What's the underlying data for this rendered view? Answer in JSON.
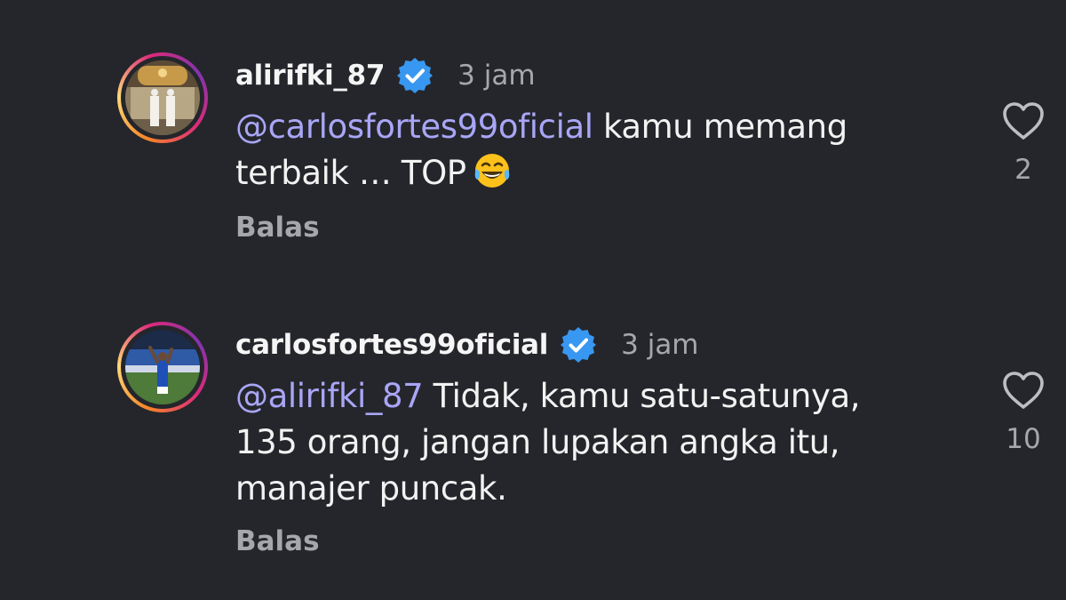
{
  "comments": [
    {
      "username": "alirifki_87",
      "verified_icon": "verified-badge-icon",
      "time": "3 jam",
      "mention": "@carlosfortes99oficial",
      "text_line1": " kamu memang",
      "text_line2": "terbaik … TOP",
      "emoji": "face-with-tears-of-joy-icon",
      "reply_label": "Balas",
      "like_icon": "heart-outline-icon",
      "like_count": "2"
    },
    {
      "username": "carlosfortes99oficial",
      "verified_icon": "verified-badge-icon",
      "time": "3 jam",
      "mention": "@alirifki_87",
      "text_line1": " Tidak, kamu satu-satunya,",
      "text_line2": "135 orang, jangan lupakan angka itu,",
      "text_line3": "manajer puncak.",
      "reply_label": "Balas",
      "like_icon": "heart-outline-icon",
      "like_count": "10"
    }
  ],
  "colors": {
    "background": "#25262b",
    "mention": "#a9a6f7",
    "muted": "#a6a7ab",
    "verified": "#3897f0"
  }
}
